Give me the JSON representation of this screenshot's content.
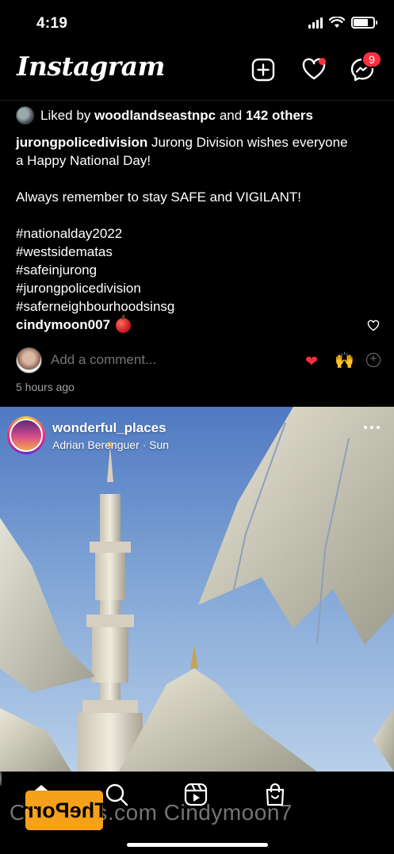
{
  "status_bar": {
    "time": "4:19",
    "battery_level": 0.75
  },
  "header": {
    "logo": "Instagram",
    "messages_badge": "9"
  },
  "post1": {
    "liked_prefix": "Liked by",
    "liked_user": "woodlandseastnpc",
    "liked_and": "and",
    "liked_others": "142 others",
    "caption_user": "jurongpolicedivision",
    "caption_line1": "Jurong Division wishes everyone",
    "caption_line2": "a Happy National Day!",
    "caption_line3": "Always remember to stay SAFE and VIGILANT!",
    "hashtags": [
      "#nationalday2022",
      "#westsidematas",
      "#safeinjurong",
      "#jurongpolicedivision",
      "#saferneighbourhoodsinsg"
    ],
    "comment_user": "cindymoon007",
    "add_comment_placeholder": "Add a comment...",
    "time_ago": "5 hours ago"
  },
  "post2": {
    "username": "wonderful_places",
    "subtitle": "Adrian Berenguer · Sun"
  },
  "watermark": {
    "text": "OnlyFans.com Cindymoon7",
    "logo_text": "ThePorn"
  },
  "icons": {
    "new_post": "plus-square-icon",
    "activity": "heart-icon",
    "messenger": "messenger-icon",
    "home": "home-icon",
    "search": "search-icon",
    "reels": "reels-icon",
    "shop": "shop-icon"
  }
}
